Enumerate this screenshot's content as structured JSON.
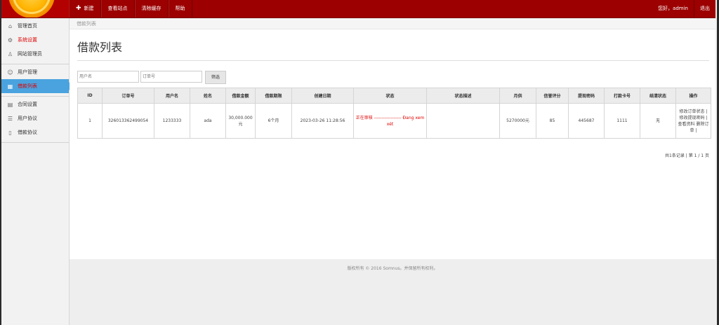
{
  "topbar": {
    "nav": [
      {
        "label": "新建",
        "icon": "plus-icon"
      },
      {
        "label": "查看站点"
      },
      {
        "label": "清除缓存"
      },
      {
        "label": "帮助"
      }
    ],
    "greeting": "您好，admin",
    "logout": "退出"
  },
  "sidebar": {
    "groups": [
      [
        {
          "label": "管理首页",
          "icon": "home-icon"
        },
        {
          "label": "系统设置",
          "icon": "gear-icon",
          "highlight": true
        },
        {
          "label": "网站管理员",
          "icon": "user-icon"
        }
      ],
      [
        {
          "label": "用户管理",
          "icon": "users-icon"
        },
        {
          "label": "借款列表",
          "icon": "grid-icon",
          "active": true
        }
      ],
      [
        {
          "label": "合同设置",
          "icon": "contract-icon"
        },
        {
          "label": "用户协议",
          "icon": "list-icon"
        },
        {
          "label": "借款协议",
          "icon": "document-icon"
        }
      ]
    ]
  },
  "breadcrumb": "借款列表",
  "page_title": "借款列表",
  "filters": {
    "username_placeholder": "用户名",
    "order_placeholder": "订单号",
    "button": "筛选"
  },
  "table": {
    "headers": [
      "ID",
      "订单号",
      "用户名",
      "姓名",
      "借款金额",
      "借款期限",
      "创建日期",
      "状态",
      "状态描述",
      "月供",
      "信誉评分",
      "提现密码",
      "打款卡号",
      "结清状态",
      "操作"
    ],
    "rows": [
      [
        "1",
        "326013362499054",
        "1233333",
        "ada",
        "30,000.000元",
        "6个月",
        "2023-03-26 11:28:56",
        "正在审核 ------------------ Đang xem xét",
        "",
        "5270000元",
        "85",
        "445687",
        "1111",
        "无",
        "修改订单状态 | 修改提现密码 | 查看资料 删除订单 |"
      ]
    ]
  },
  "pager": "共1条记录 | 第 1 / 1 页",
  "footer": "版权所有 © 2016 Somnus。并保留所有权利。",
  "colors": {
    "topbar": "#9c0000",
    "active": "#4aa3df",
    "status_red": "#e00000"
  }
}
